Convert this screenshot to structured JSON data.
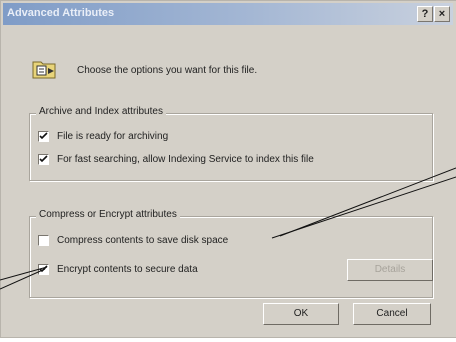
{
  "window": {
    "title": "Advanced Attributes",
    "help_label": "?",
    "close_label": "×"
  },
  "header": {
    "text": "Choose the options you want for this file.",
    "icon": "folder-settings-icon"
  },
  "archive_group": {
    "title": "Archive and Index attributes",
    "items": [
      {
        "label": "File is ready for archiving",
        "checked": true
      },
      {
        "label": "For fast searching, allow Indexing Service to index this file",
        "checked": true
      }
    ]
  },
  "compress_group": {
    "title": "Compress or Encrypt attributes",
    "items": [
      {
        "label": "Compress contents to save disk space",
        "checked": false
      },
      {
        "label": "Encrypt contents to secure data",
        "checked": true
      }
    ],
    "details_label": "Details"
  },
  "buttons": {
    "ok": "OK",
    "cancel": "Cancel"
  },
  "colors": {
    "dialog": "#d4d0c8",
    "titlebar": "#7f9cc7"
  }
}
